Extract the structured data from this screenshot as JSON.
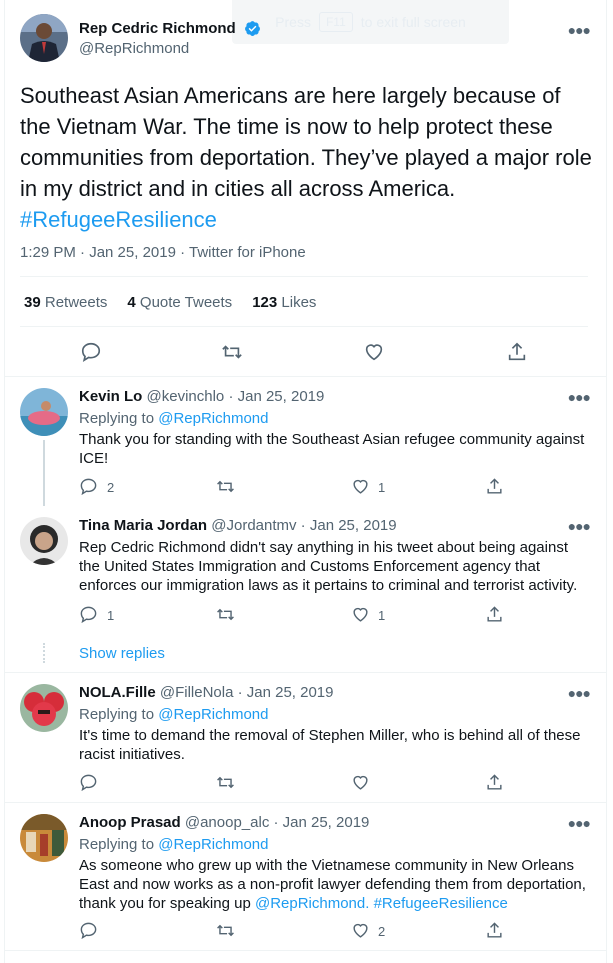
{
  "toast": {
    "pre": "Press",
    "key": "F11",
    "post": "to exit full screen"
  },
  "main": {
    "name": "Rep Cedric Richmond",
    "handle": "@RepRichmond",
    "text": "Southeast Asian Americans are here largely because of the Vietnam War. The time is now to help protect these communities from deportation. They’ve played a major role in my district and in cities all across America.",
    "hashtag": "#RefugeeResilience",
    "meta": "1:29 PM · Jan 25, 2019 · Twitter for iPhone",
    "stats": {
      "retweets_n": "39",
      "retweets_label": "Retweets",
      "quotes_n": "4",
      "quotes_label": "Quote Tweets",
      "likes_n": "123",
      "likes_label": "Likes"
    }
  },
  "replies": [
    {
      "name": "Kevin Lo",
      "handle_date": "@kevinchlo · Jan 25, 2019",
      "replying_prefix": "Replying to",
      "replying_to": "@RepRichmond",
      "body": "Thank you for standing with the Southeast Asian refugee community against ICE!",
      "reply_count": "2",
      "like_count": "1"
    },
    {
      "name": "Tina Maria Jordan",
      "handle_date": "@Jordantmv · Jan 25, 2019",
      "body": "Rep Cedric Richmond didn't say anything in his tweet about being against the United States Immigration and Customs Enforcement agency that enforces our immigration laws as it pertains to criminal and terrorist activity.",
      "reply_count": "1",
      "like_count": "1"
    },
    {
      "name": "NOLA.Fille",
      "handle_date": "@FilleNola · Jan 25, 2019",
      "replying_prefix": "Replying to",
      "replying_to": "@RepRichmond",
      "body": "It's time to demand the removal of Stephen Miller, who is behind all of these racist initiatives.",
      "reply_count": "",
      "like_count": ""
    },
    {
      "name": "Anoop Prasad",
      "handle_date": "@anoop_alc · Jan 25, 2019",
      "replying_prefix": "Replying to",
      "replying_to": "@RepRichmond",
      "body": "As someone who grew up with the Vietnamese community in New Orleans East and now works as a non-profit lawyer defending them from deportation, thank you for speaking up",
      "mention": "@RepRichmond.",
      "hashtag": "#RefugeeResilience",
      "reply_count": "",
      "like_count": "2"
    }
  ],
  "show_replies": "Show replies",
  "colors": {
    "accent": "#1d9bf0",
    "secondary_text": "#536471",
    "divider": "#eff3f4"
  }
}
